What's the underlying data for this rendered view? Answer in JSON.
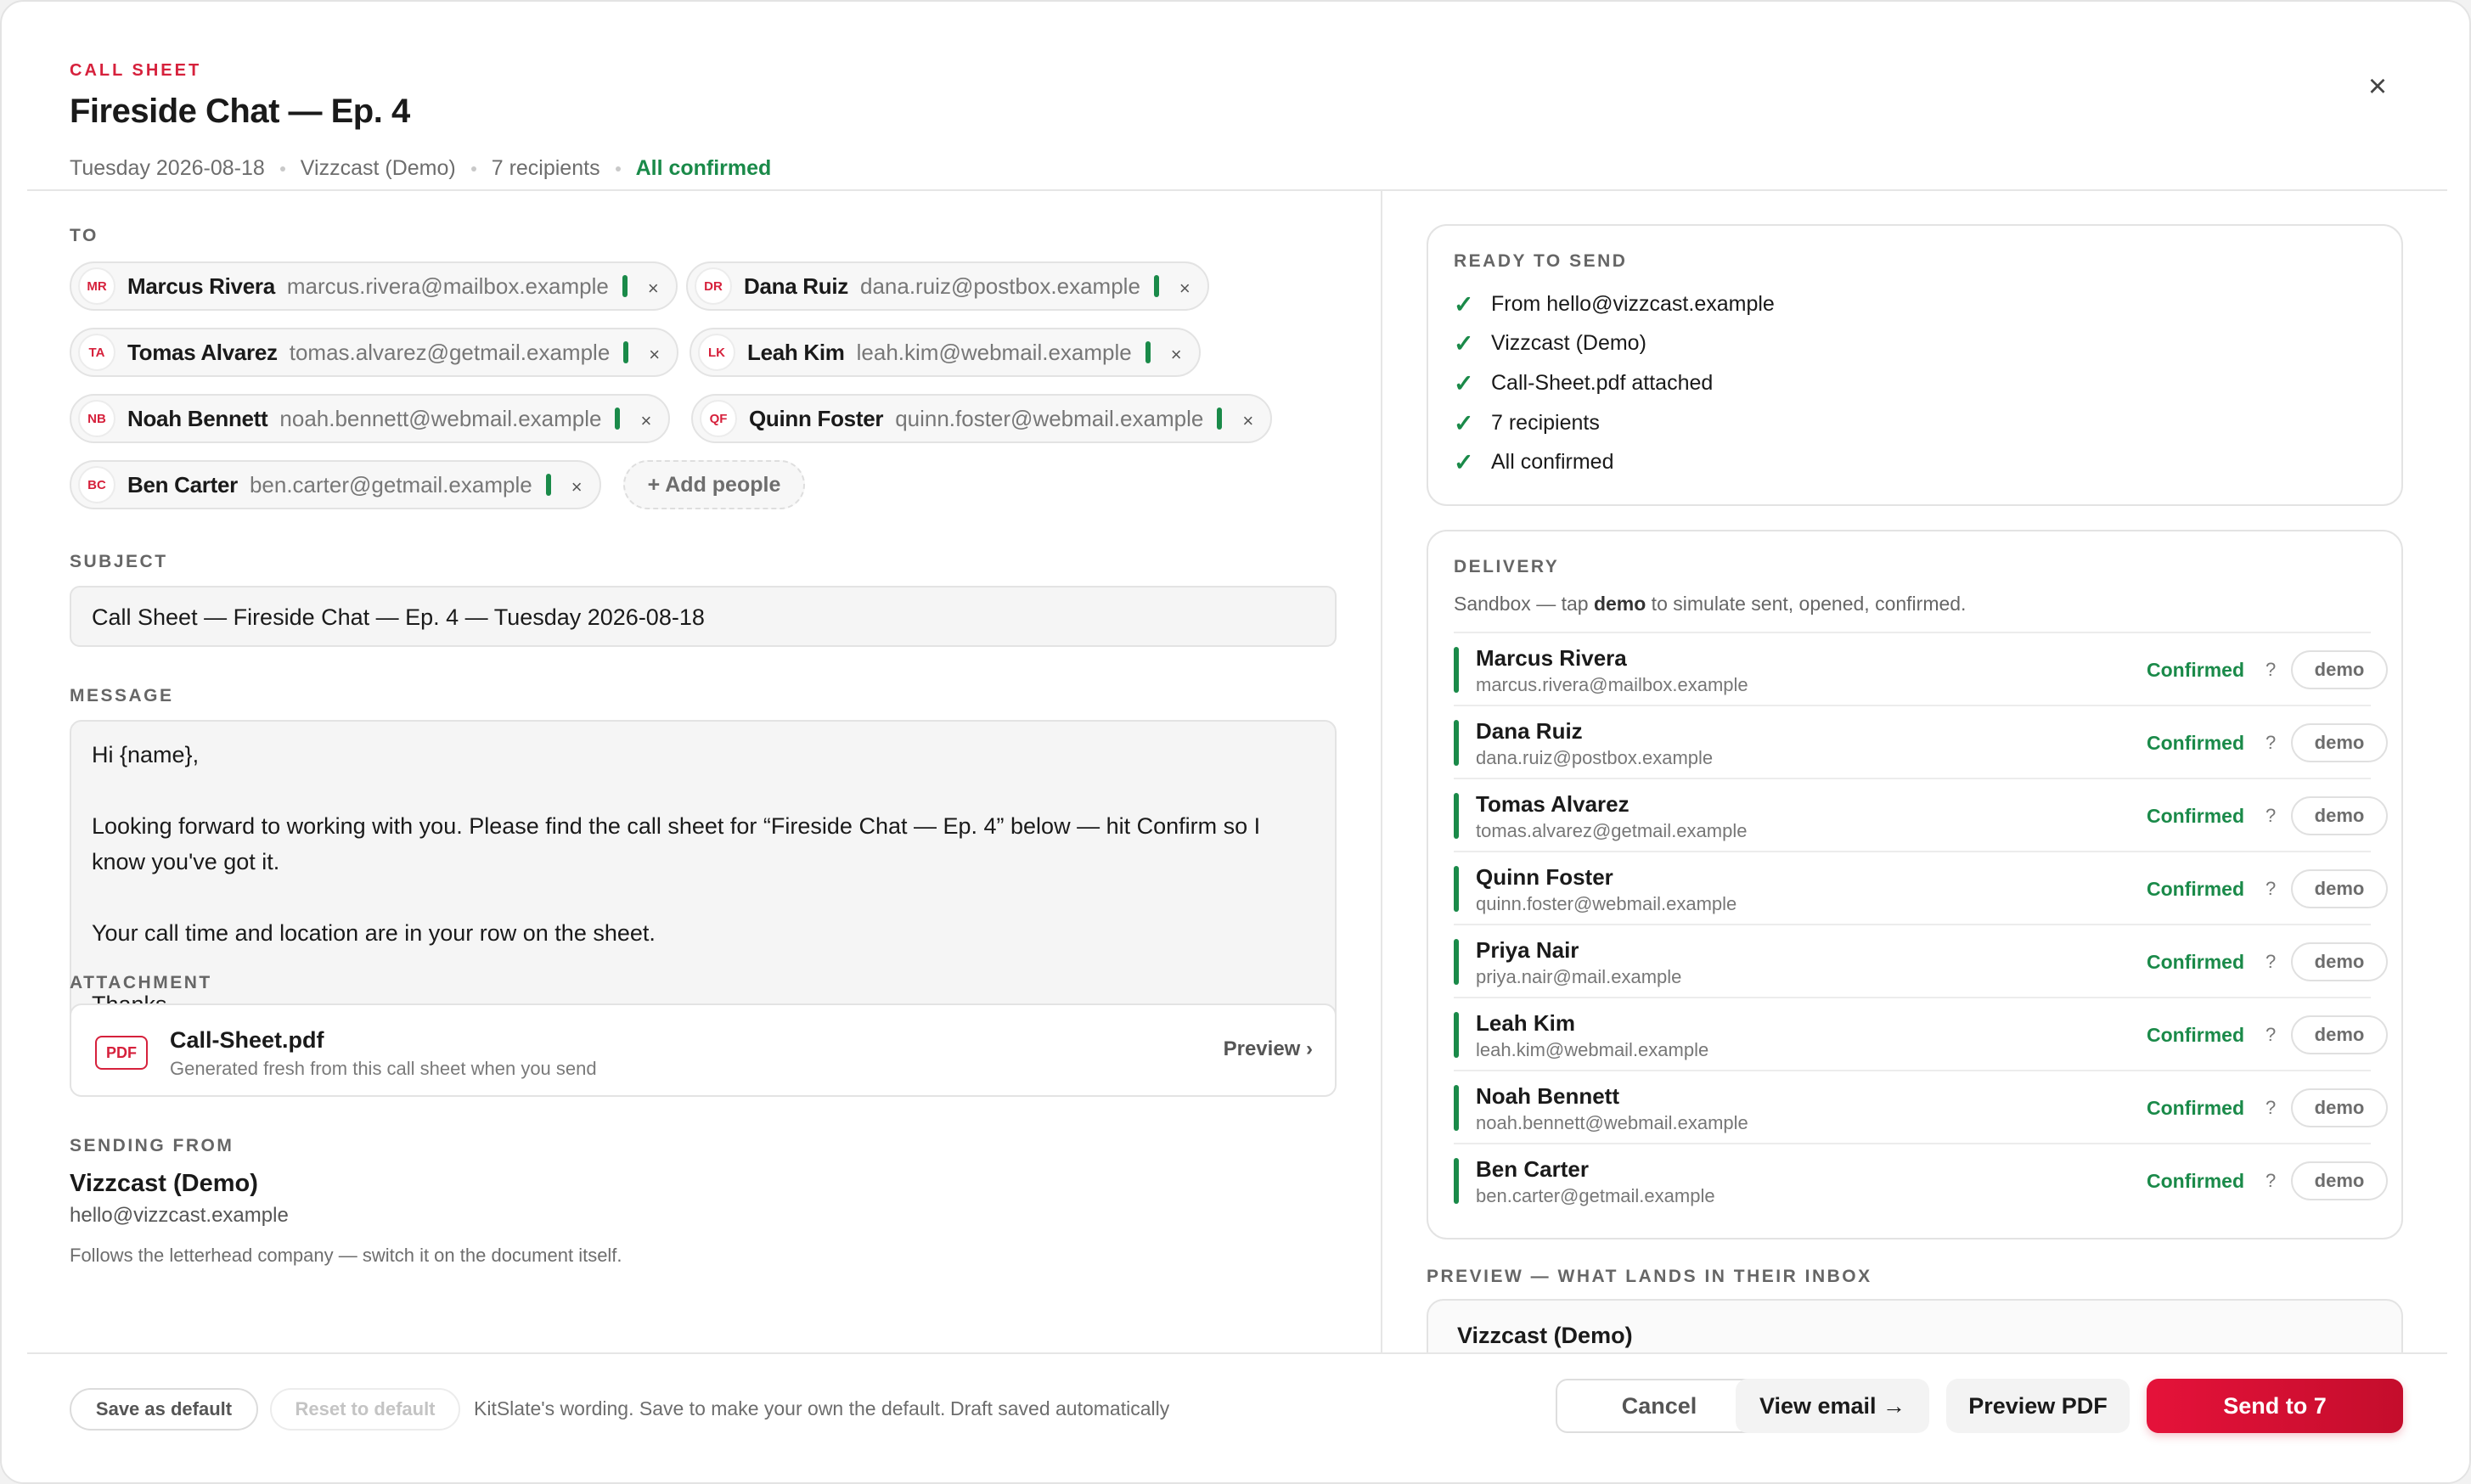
{
  "header": {
    "eyebrow": "CALL SHEET",
    "title": "Fireside Chat — Ep. 4",
    "date": "Tuesday 2026-08-18",
    "company": "Vizzcast (Demo)",
    "recipients": "7 recipients",
    "status": "All confirmed",
    "close_icon": "×"
  },
  "to": {
    "label": "TO",
    "chips": [
      {
        "initials": "MR",
        "name": "Marcus Rivera",
        "email": "marcus.rivera@mailbox.example",
        "remove": "×"
      },
      {
        "initials": "DR",
        "name": "Dana Ruiz",
        "email": "dana.ruiz@postbox.example",
        "remove": "×"
      },
      {
        "initials": "TA",
        "name": "Tomas Alvarez",
        "email": "tomas.alvarez@getmail.example",
        "remove": "×"
      },
      {
        "initials": "LK",
        "name": "Leah Kim",
        "email": "leah.kim@webmail.example",
        "remove": "×"
      },
      {
        "initials": "NB",
        "name": "Noah Bennett",
        "email": "noah.bennett@webmail.example",
        "remove": "×"
      },
      {
        "initials": "QF",
        "name": "Quinn Foster",
        "email": "quinn.foster@webmail.example",
        "remove": "×"
      },
      {
        "initials": "BC",
        "name": "Ben Carter",
        "email": "ben.carter@getmail.example",
        "remove": "×"
      }
    ],
    "add_people": "+ Add people"
  },
  "subject": {
    "label": "SUBJECT",
    "value": "Call Sheet — Fireside Chat — Ep. 4 — Tuesday 2026-08-18"
  },
  "message": {
    "label": "MESSAGE",
    "lines": [
      "Hi {name},",
      "Looking forward to working with you. Please find the call sheet for “Fireside Chat — Ep. 4” below — hit Confirm so I know you've got it.",
      "Your call time and location are in your row on the sheet.",
      "Thanks,"
    ]
  },
  "attachment": {
    "label": "ATTACHMENT",
    "badge": "PDF",
    "filename": "Call-Sheet.pdf",
    "subtitle": "Generated fresh from this call sheet when you send",
    "preview": "Preview ›"
  },
  "sending_from": {
    "label": "SENDING FROM",
    "name": "Vizzcast (Demo)",
    "email": "hello@vizzcast.example",
    "note": "Follows the letterhead company — switch it on the document itself."
  },
  "ready": {
    "label": "READY TO SEND",
    "tick": "✓",
    "items": [
      "From hello@vizzcast.example",
      "Vizzcast (Demo)",
      "Call-Sheet.pdf attached",
      "7 recipients",
      "All confirmed"
    ]
  },
  "delivery": {
    "label": "DELIVERY",
    "note_pre": "Sandbox — tap ",
    "note_bold": "demo",
    "note_post": " to simulate sent, opened, confirmed.",
    "rows": [
      {
        "name": "Marcus Rivera",
        "email": "marcus.rivera@mailbox.example",
        "status": "Confirmed",
        "help": "?",
        "demo": "demo"
      },
      {
        "name": "Dana Ruiz",
        "email": "dana.ruiz@postbox.example",
        "status": "Confirmed",
        "help": "?",
        "demo": "demo"
      },
      {
        "name": "Tomas Alvarez",
        "email": "tomas.alvarez@getmail.example",
        "status": "Confirmed",
        "help": "?",
        "demo": "demo"
      },
      {
        "name": "Quinn Foster",
        "email": "quinn.foster@webmail.example",
        "status": "Confirmed",
        "help": "?",
        "demo": "demo"
      },
      {
        "name": "Priya Nair",
        "email": "priya.nair@mail.example",
        "status": "Confirmed",
        "help": "?",
        "demo": "demo"
      },
      {
        "name": "Leah Kim",
        "email": "leah.kim@webmail.example",
        "status": "Confirmed",
        "help": "?",
        "demo": "demo"
      },
      {
        "name": "Noah Bennett",
        "email": "noah.bennett@webmail.example",
        "status": "Confirmed",
        "help": "?",
        "demo": "demo"
      },
      {
        "name": "Ben Carter",
        "email": "ben.carter@getmail.example",
        "status": "Confirmed",
        "help": "?",
        "demo": "demo"
      }
    ]
  },
  "preview": {
    "label": "PREVIEW — WHAT LANDS IN THEIR INBOX",
    "sender": "Vizzcast (Demo)"
  },
  "footer": {
    "save_default": "Save as default",
    "reset_default": "Reset to default",
    "note": "KitSlate's wording. Save to make your own the default.",
    "draft": "Draft saved automatically",
    "cancel": "Cancel",
    "view_email": "View email →",
    "preview_pdf": "Preview PDF",
    "send": "Send to 7"
  },
  "colors": {
    "accent": "#d6213c",
    "success": "#1a8a49",
    "send_button": "#d9102f"
  }
}
